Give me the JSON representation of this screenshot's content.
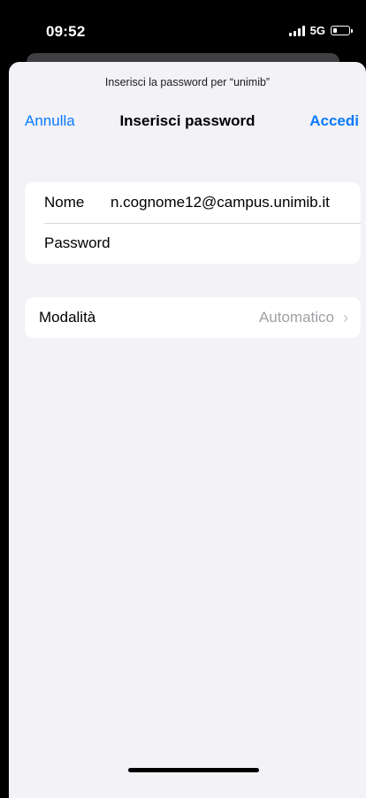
{
  "status_bar": {
    "time": "09:52",
    "network": "5G",
    "icons": [
      "signal-icon",
      "battery-icon"
    ]
  },
  "sheet": {
    "prompt": "Inserisci la password per “unimib”",
    "nav": {
      "cancel_label": "Annulla",
      "title": "Inserisci password",
      "login_label": "Accedi"
    },
    "credentials": {
      "name_label": "Nome",
      "name_value": "n.cognome12@campus.unimib.it",
      "password_label": "Password",
      "password_value": ""
    },
    "mode": {
      "label": "Modalità",
      "value": "Automatico",
      "icon": "chevron-right-icon"
    }
  },
  "colors": {
    "accent": "#0a7aff",
    "background": "#f2f2f7",
    "secondary_text": "#a0a0a6"
  }
}
